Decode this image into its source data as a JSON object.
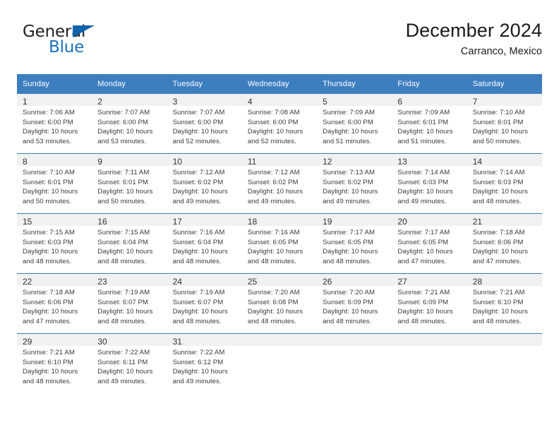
{
  "brand": {
    "name_part1": "General",
    "name_part2": "Blue",
    "accent_color": "#1b72bd",
    "triangle_color": "#1263ad"
  },
  "header": {
    "title": "December 2024",
    "subtitle": "Carranco, Mexico"
  },
  "theme": {
    "header_bg": "#3d7ebf",
    "header_text": "#ffffff",
    "daynum_bg": "#f1f1f1",
    "grid_line": "#3d7ebf"
  },
  "weekday_headers": [
    "Sunday",
    "Monday",
    "Tuesday",
    "Wednesday",
    "Thursday",
    "Friday",
    "Saturday"
  ],
  "weeks": [
    [
      {
        "day": "1",
        "sunrise": "Sunrise: 7:06 AM",
        "sunset": "Sunset: 6:00 PM",
        "daylight_line1": "Daylight: 10 hours",
        "daylight_line2": "and 53 minutes."
      },
      {
        "day": "2",
        "sunrise": "Sunrise: 7:07 AM",
        "sunset": "Sunset: 6:00 PM",
        "daylight_line1": "Daylight: 10 hours",
        "daylight_line2": "and 53 minutes."
      },
      {
        "day": "3",
        "sunrise": "Sunrise: 7:07 AM",
        "sunset": "Sunset: 6:00 PM",
        "daylight_line1": "Daylight: 10 hours",
        "daylight_line2": "and 52 minutes."
      },
      {
        "day": "4",
        "sunrise": "Sunrise: 7:08 AM",
        "sunset": "Sunset: 6:00 PM",
        "daylight_line1": "Daylight: 10 hours",
        "daylight_line2": "and 52 minutes."
      },
      {
        "day": "5",
        "sunrise": "Sunrise: 7:09 AM",
        "sunset": "Sunset: 6:00 PM",
        "daylight_line1": "Daylight: 10 hours",
        "daylight_line2": "and 51 minutes."
      },
      {
        "day": "6",
        "sunrise": "Sunrise: 7:09 AM",
        "sunset": "Sunset: 6:01 PM",
        "daylight_line1": "Daylight: 10 hours",
        "daylight_line2": "and 51 minutes."
      },
      {
        "day": "7",
        "sunrise": "Sunrise: 7:10 AM",
        "sunset": "Sunset: 6:01 PM",
        "daylight_line1": "Daylight: 10 hours",
        "daylight_line2": "and 50 minutes."
      }
    ],
    [
      {
        "day": "8",
        "sunrise": "Sunrise: 7:10 AM",
        "sunset": "Sunset: 6:01 PM",
        "daylight_line1": "Daylight: 10 hours",
        "daylight_line2": "and 50 minutes."
      },
      {
        "day": "9",
        "sunrise": "Sunrise: 7:11 AM",
        "sunset": "Sunset: 6:01 PM",
        "daylight_line1": "Daylight: 10 hours",
        "daylight_line2": "and 50 minutes."
      },
      {
        "day": "10",
        "sunrise": "Sunrise: 7:12 AM",
        "sunset": "Sunset: 6:02 PM",
        "daylight_line1": "Daylight: 10 hours",
        "daylight_line2": "and 49 minutes."
      },
      {
        "day": "11",
        "sunrise": "Sunrise: 7:12 AM",
        "sunset": "Sunset: 6:02 PM",
        "daylight_line1": "Daylight: 10 hours",
        "daylight_line2": "and 49 minutes."
      },
      {
        "day": "12",
        "sunrise": "Sunrise: 7:13 AM",
        "sunset": "Sunset: 6:02 PM",
        "daylight_line1": "Daylight: 10 hours",
        "daylight_line2": "and 49 minutes."
      },
      {
        "day": "13",
        "sunrise": "Sunrise: 7:14 AM",
        "sunset": "Sunset: 6:03 PM",
        "daylight_line1": "Daylight: 10 hours",
        "daylight_line2": "and 49 minutes."
      },
      {
        "day": "14",
        "sunrise": "Sunrise: 7:14 AM",
        "sunset": "Sunset: 6:03 PM",
        "daylight_line1": "Daylight: 10 hours",
        "daylight_line2": "and 48 minutes."
      }
    ],
    [
      {
        "day": "15",
        "sunrise": "Sunrise: 7:15 AM",
        "sunset": "Sunset: 6:03 PM",
        "daylight_line1": "Daylight: 10 hours",
        "daylight_line2": "and 48 minutes."
      },
      {
        "day": "16",
        "sunrise": "Sunrise: 7:15 AM",
        "sunset": "Sunset: 6:04 PM",
        "daylight_line1": "Daylight: 10 hours",
        "daylight_line2": "and 48 minutes."
      },
      {
        "day": "17",
        "sunrise": "Sunrise: 7:16 AM",
        "sunset": "Sunset: 6:04 PM",
        "daylight_line1": "Daylight: 10 hours",
        "daylight_line2": "and 48 minutes."
      },
      {
        "day": "18",
        "sunrise": "Sunrise: 7:16 AM",
        "sunset": "Sunset: 6:05 PM",
        "daylight_line1": "Daylight: 10 hours",
        "daylight_line2": "and 48 minutes."
      },
      {
        "day": "19",
        "sunrise": "Sunrise: 7:17 AM",
        "sunset": "Sunset: 6:05 PM",
        "daylight_line1": "Daylight: 10 hours",
        "daylight_line2": "and 48 minutes."
      },
      {
        "day": "20",
        "sunrise": "Sunrise: 7:17 AM",
        "sunset": "Sunset: 6:05 PM",
        "daylight_line1": "Daylight: 10 hours",
        "daylight_line2": "and 47 minutes."
      },
      {
        "day": "21",
        "sunrise": "Sunrise: 7:18 AM",
        "sunset": "Sunset: 6:06 PM",
        "daylight_line1": "Daylight: 10 hours",
        "daylight_line2": "and 47 minutes."
      }
    ],
    [
      {
        "day": "22",
        "sunrise": "Sunrise: 7:18 AM",
        "sunset": "Sunset: 6:06 PM",
        "daylight_line1": "Daylight: 10 hours",
        "daylight_line2": "and 47 minutes."
      },
      {
        "day": "23",
        "sunrise": "Sunrise: 7:19 AM",
        "sunset": "Sunset: 6:07 PM",
        "daylight_line1": "Daylight: 10 hours",
        "daylight_line2": "and 48 minutes."
      },
      {
        "day": "24",
        "sunrise": "Sunrise: 7:19 AM",
        "sunset": "Sunset: 6:07 PM",
        "daylight_line1": "Daylight: 10 hours",
        "daylight_line2": "and 48 minutes."
      },
      {
        "day": "25",
        "sunrise": "Sunrise: 7:20 AM",
        "sunset": "Sunset: 6:08 PM",
        "daylight_line1": "Daylight: 10 hours",
        "daylight_line2": "and 48 minutes."
      },
      {
        "day": "26",
        "sunrise": "Sunrise: 7:20 AM",
        "sunset": "Sunset: 6:09 PM",
        "daylight_line1": "Daylight: 10 hours",
        "daylight_line2": "and 48 minutes."
      },
      {
        "day": "27",
        "sunrise": "Sunrise: 7:21 AM",
        "sunset": "Sunset: 6:09 PM",
        "daylight_line1": "Daylight: 10 hours",
        "daylight_line2": "and 48 minutes."
      },
      {
        "day": "28",
        "sunrise": "Sunrise: 7:21 AM",
        "sunset": "Sunset: 6:10 PM",
        "daylight_line1": "Daylight: 10 hours",
        "daylight_line2": "and 48 minutes."
      }
    ],
    [
      {
        "day": "29",
        "sunrise": "Sunrise: 7:21 AM",
        "sunset": "Sunset: 6:10 PM",
        "daylight_line1": "Daylight: 10 hours",
        "daylight_line2": "and 48 minutes."
      },
      {
        "day": "30",
        "sunrise": "Sunrise: 7:22 AM",
        "sunset": "Sunset: 6:11 PM",
        "daylight_line1": "Daylight: 10 hours",
        "daylight_line2": "and 49 minutes."
      },
      {
        "day": "31",
        "sunrise": "Sunrise: 7:22 AM",
        "sunset": "Sunset: 6:12 PM",
        "daylight_line1": "Daylight: 10 hours",
        "daylight_line2": "and 49 minutes."
      },
      {
        "day": "",
        "sunrise": "",
        "sunset": "",
        "daylight_line1": "",
        "daylight_line2": ""
      },
      {
        "day": "",
        "sunrise": "",
        "sunset": "",
        "daylight_line1": "",
        "daylight_line2": ""
      },
      {
        "day": "",
        "sunrise": "",
        "sunset": "",
        "daylight_line1": "",
        "daylight_line2": ""
      },
      {
        "day": "",
        "sunrise": "",
        "sunset": "",
        "daylight_line1": "",
        "daylight_line2": ""
      }
    ]
  ]
}
